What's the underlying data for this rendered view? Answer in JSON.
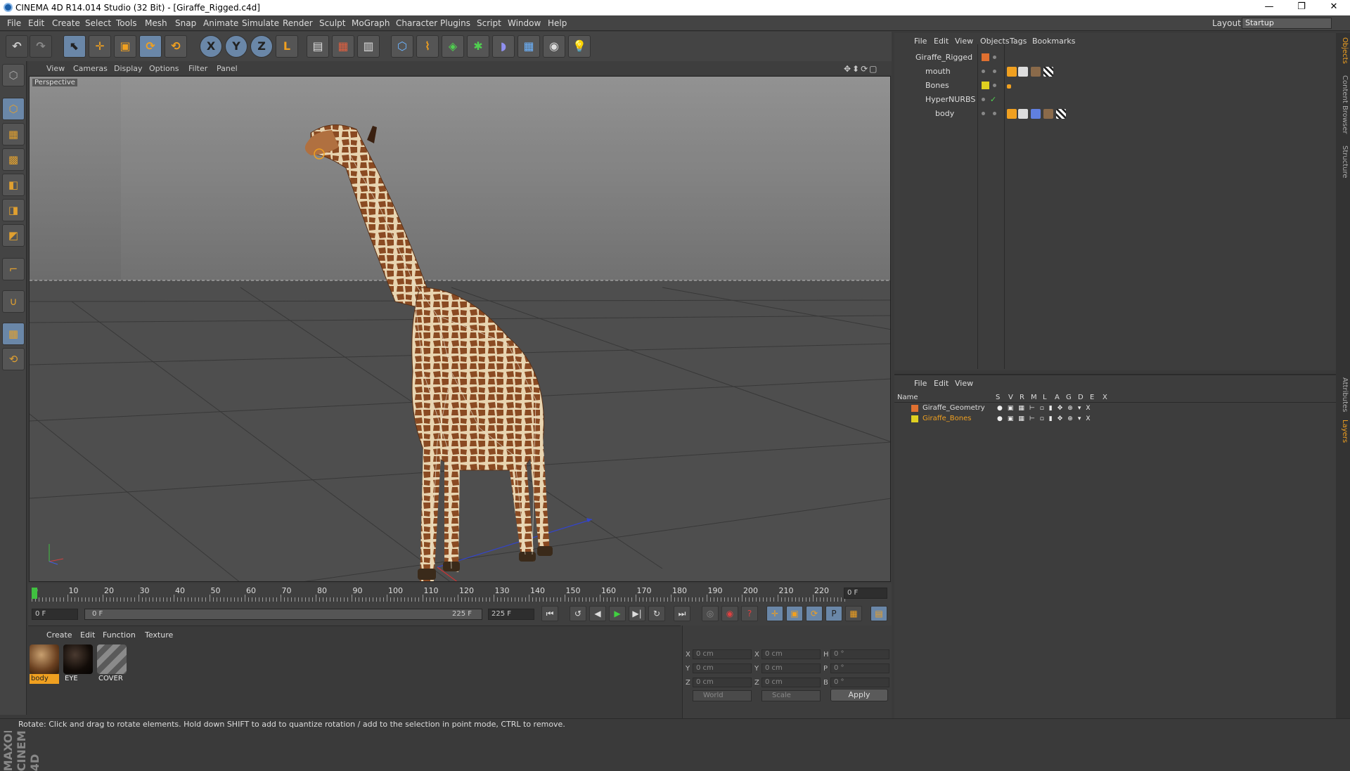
{
  "title_bar": {
    "title": "CINEMA 4D R14.014 Studio (32 Bit) - [Giraffe_Rigged.c4d]",
    "minimize": "—",
    "maximize": "❐",
    "close": "✕"
  },
  "menu": [
    "File",
    "Edit",
    "Create",
    "Select",
    "Tools",
    "Mesh",
    "Snap",
    "Animate",
    "Simulate",
    "Render",
    "Sculpt",
    "MoGraph",
    "Character",
    "Plugins",
    "Script",
    "Window",
    "Help"
  ],
  "layout": {
    "label": "Layout:",
    "value": "Startup"
  },
  "toolbar": {
    "undo": "↶",
    "redo": "↷",
    "select": "⬉",
    "move": "✛",
    "scale": "▣",
    "rotate": "⟳",
    "recent": "⟲",
    "x": "X",
    "y": "Y",
    "z": "Z",
    "coords": "L",
    "render_view": "▤",
    "render": "▦",
    "render_settings": "▥",
    "cube": "⬡",
    "spline": "⌇",
    "nurbs": "◈",
    "array": "✱",
    "deformer": "◗",
    "floor": "▦",
    "camera": "◉",
    "light": "💡"
  },
  "left_tools": [
    "⬡",
    "▦",
    "▩",
    "◧",
    "◨",
    "◩",
    "⌐",
    "∪",
    "▦",
    "⟲"
  ],
  "viewport": {
    "menu": [
      "View",
      "Cameras",
      "Display",
      "Options",
      "Filter",
      "Panel"
    ],
    "label": "Perspective",
    "nav_icons": "✥⬍⟳▢"
  },
  "timeline": {
    "ticks": [
      "0",
      "10",
      "20",
      "30",
      "40",
      "50",
      "60",
      "70",
      "80",
      "90",
      "100",
      "110",
      "120",
      "130",
      "140",
      "150",
      "160",
      "170",
      "180",
      "190",
      "200",
      "210",
      "220"
    ],
    "current_frame": "0 F",
    "start_field": "0 F",
    "range_min": "0 F",
    "range_max": "225 F",
    "end_field": "225 F"
  },
  "playback": {
    "first": "⏮",
    "loop": "↺",
    "prev": "◀",
    "play": "▶",
    "next": "▶|",
    "repeat": "↻",
    "last": "⏭",
    "rec": "◎",
    "auto": "◉",
    "help": "?",
    "move": "✛",
    "scale": "▣",
    "rotate": "⟳",
    "param": "P",
    "pla": "▦",
    "timeline": "▤"
  },
  "materials": {
    "menu": [
      "Create",
      "Edit",
      "Function",
      "Texture"
    ],
    "items": [
      {
        "label": "body",
        "selected": true,
        "color": "#7a5a3a"
      },
      {
        "label": "EYE",
        "selected": false,
        "color": "#1a1410"
      },
      {
        "label": "COVER",
        "selected": false,
        "color": "#6a6a6a"
      }
    ]
  },
  "coords": {
    "rows": [
      {
        "a": "X",
        "av": "0 cm",
        "b": "X",
        "bv": "0 cm",
        "c": "H",
        "cv": "0 °"
      },
      {
        "a": "Y",
        "av": "0 cm",
        "b": "Y",
        "bv": "0 cm",
        "c": "P",
        "cv": "0 °"
      },
      {
        "a": "Z",
        "av": "0 cm",
        "b": "Z",
        "bv": "0 cm",
        "c": "B",
        "cv": "0 °"
      }
    ],
    "mode1": "World",
    "mode2": "Scale",
    "apply": "Apply"
  },
  "objects": {
    "menu": [
      "File",
      "Edit",
      "View",
      "Objects",
      "Tags",
      "Bookmarks"
    ],
    "items": [
      {
        "name": "Giraffe_Rigged",
        "indent": 0,
        "swatch": "#e07030"
      },
      {
        "name": "mouth",
        "indent": 1,
        "swatch": ""
      },
      {
        "name": "Bones",
        "indent": 1,
        "swatch": "#e0d020"
      },
      {
        "name": "HyperNURBS",
        "indent": 1,
        "swatch": ""
      },
      {
        "name": "body",
        "indent": 2,
        "swatch": ""
      }
    ]
  },
  "layers": {
    "menu": [
      "File",
      "Edit",
      "View"
    ],
    "headers": [
      "Name",
      "S",
      "V",
      "R",
      "M",
      "L",
      "A",
      "G",
      "D",
      "E",
      "X"
    ],
    "items": [
      {
        "name": "Giraffe_Geometry",
        "color": "#e07030",
        "text_color": "#dddddd"
      },
      {
        "name": "Giraffe_Bones",
        "color": "#e0d020",
        "text_color": "#f0a020"
      }
    ]
  },
  "side_tabs": [
    "Objects",
    "Content Browser",
    "Structure",
    "Attributes",
    "Layers"
  ],
  "brand": "MAXON CINEMA 4D",
  "status": "Rotate: Click and drag to rotate elements. Hold down SHIFT to add to quantize rotation / add to the selection in point mode, CTRL to remove."
}
